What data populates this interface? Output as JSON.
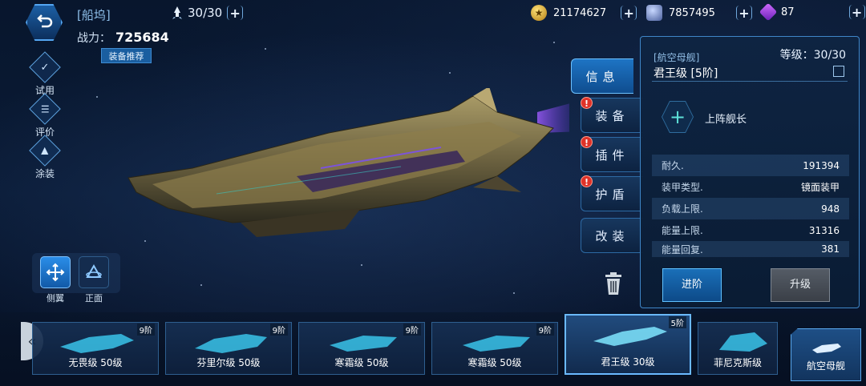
{
  "header": {
    "dock_title": "[船坞]",
    "ship_count": "30/30",
    "power_label": "战力：",
    "power_value": "725684",
    "equip_recommend": "装备推荐"
  },
  "resources": [
    {
      "icon": "gold-coin-icon",
      "value": "21174627"
    },
    {
      "icon": "ore-icon",
      "value": "7857495"
    },
    {
      "icon": "gem-icon",
      "value": "87"
    }
  ],
  "side_actions": [
    {
      "icon": "trial-icon",
      "label": "试用"
    },
    {
      "icon": "review-icon",
      "label": "评价"
    },
    {
      "icon": "paint-icon",
      "label": "涂装"
    }
  ],
  "view_modes": {
    "side_label": "侧翼",
    "front_label": "正面"
  },
  "tabs": [
    {
      "label": "信息",
      "active": true,
      "alert": false
    },
    {
      "label": "装备",
      "active": false,
      "alert": true
    },
    {
      "label": "插件",
      "active": false,
      "alert": true
    },
    {
      "label": "护盾",
      "active": false,
      "alert": true
    },
    {
      "label": "改装",
      "active": false,
      "alert": false
    }
  ],
  "alert_glyph": "!",
  "info": {
    "class_tag": "[航空母舰]",
    "level_label": "等级：30/30",
    "ship_name": "君王级 [5阶]",
    "captain_label": "上阵舰长",
    "stats": [
      {
        "label": "耐久.",
        "value": "191394"
      },
      {
        "label": "装甲类型.",
        "value": "镜面装甲"
      },
      {
        "label": "负载上限.",
        "value": "948"
      },
      {
        "label": "能量上限.",
        "value": "31316"
      },
      {
        "label": "能量回复.",
        "value": "381"
      }
    ],
    "advance_label": "进阶",
    "upgrade_label": "升级"
  },
  "ships": [
    {
      "tier": "9阶",
      "name": "无畏级 50级",
      "selected": false
    },
    {
      "tier": "9阶",
      "name": "芬里尔级 50级",
      "selected": false
    },
    {
      "tier": "9阶",
      "name": "寒霜级 50级",
      "selected": false
    },
    {
      "tier": "9阶",
      "name": "寒霜级 50级",
      "selected": false
    },
    {
      "tier": "5阶",
      "name": "君王级 30级",
      "selected": true
    },
    {
      "tier": "",
      "name": "菲尼克斯级",
      "selected": false
    }
  ],
  "category_button": "航空母舰",
  "colors": {
    "accent": "#1e74c4",
    "highlight": "#6ab9ff",
    "alert": "#e03228",
    "hologram": "#3fd8ff"
  }
}
